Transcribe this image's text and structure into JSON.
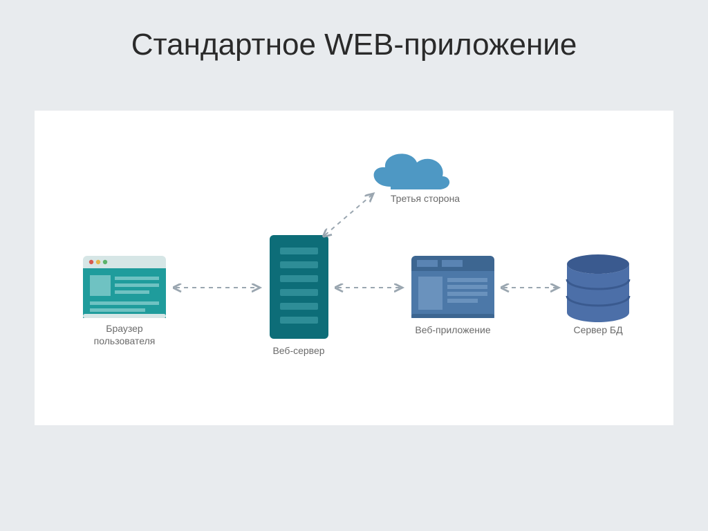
{
  "title": "Стандартное WEB-приложение",
  "nodes": {
    "browser": {
      "label1": "Браузер",
      "label2": "пользователя"
    },
    "server": {
      "label": "Веб-сервер"
    },
    "cloud": {
      "label": "Третья сторона"
    },
    "app": {
      "label": "Веб-приложение"
    },
    "db": {
      "label": "Сервер БД"
    }
  },
  "colors": {
    "browser_body": "#1f9c9c",
    "browser_header": "#d6e6e6",
    "server": "#0d6d78",
    "cloud": "#4e98c4",
    "app_body": "#4c78a8",
    "app_header": "#3d6691",
    "db": "#4c6fa8",
    "arrow": "#9aa6b0"
  }
}
